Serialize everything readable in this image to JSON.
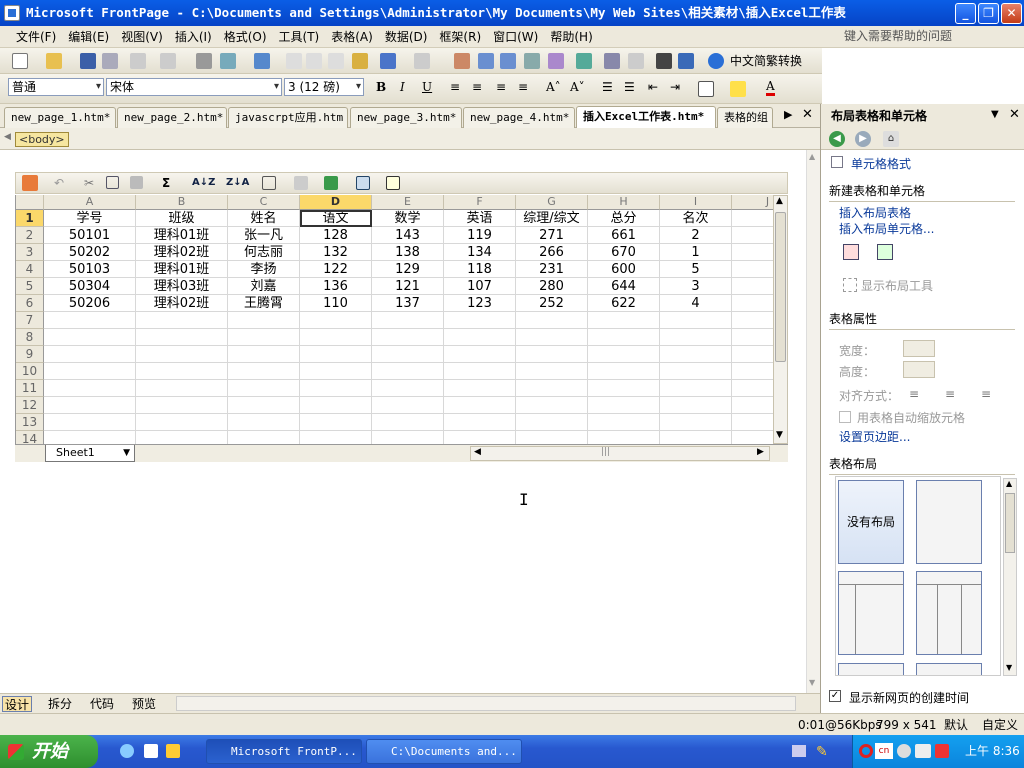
{
  "window": {
    "title": "Microsoft FrontPage - C:\\Documents and Settings\\Administrator\\My Documents\\My Web Sites\\相关素材\\插入Excel工作表"
  },
  "menu": {
    "items": [
      "文件(F)",
      "编辑(E)",
      "视图(V)",
      "插入(I)",
      "格式(O)",
      "工具(T)",
      "表格(A)",
      "数据(D)",
      "框架(R)",
      "窗口(W)",
      "帮助(H)"
    ],
    "help_placeholder": "键入需要帮助的问题"
  },
  "toolbar": {
    "convert_label": "中文简繁转换",
    "style_value": "普通",
    "font_value": "宋体",
    "size_value": "3 (12 磅)"
  },
  "tabs": [
    "new_page_1.htm*",
    "new_page_2.htm*",
    "javascrpt应用.htm",
    "new_page_3.htm*",
    "new_page_4.htm*",
    "插入Excel工作表.htm*",
    "表格的组"
  ],
  "breadcrumb": {
    "tag": "<body>"
  },
  "spreadsheet": {
    "columns": [
      "A",
      "B",
      "C",
      "D",
      "E",
      "F",
      "G",
      "H",
      "I",
      "J"
    ],
    "rows": [
      [
        "学号",
        "班级",
        "姓名",
        "语文",
        "数学",
        "英语",
        "综理/综文",
        "总分",
        "名次"
      ],
      [
        "50101",
        "理科01班",
        "张一凡",
        "128",
        "143",
        "119",
        "271",
        "661",
        "2"
      ],
      [
        "50202",
        "理科02班",
        "何志丽",
        "132",
        "138",
        "134",
        "266",
        "670",
        "1"
      ],
      [
        "50103",
        "理科01班",
        "李扬",
        "122",
        "129",
        "118",
        "231",
        "600",
        "5"
      ],
      [
        "50304",
        "理科03班",
        "刘嘉",
        "136",
        "121",
        "107",
        "280",
        "644",
        "3"
      ],
      [
        "50206",
        "理科02班",
        "王腾霄",
        "110",
        "137",
        "123",
        "252",
        "622",
        "4"
      ]
    ],
    "row_numbers": [
      "1",
      "2",
      "3",
      "4",
      "5",
      "6",
      "7",
      "8",
      "9",
      "10",
      "11",
      "12",
      "13",
      "14"
    ],
    "sheet_tab": "Sheet1"
  },
  "taskpane": {
    "title": "布局表格和单元格",
    "cell_format": "单元格格式",
    "new_section": "新建表格和单元格",
    "insert_table": "插入布局表格",
    "insert_cell": "插入布局单元格...",
    "show_tools": "显示布局工具",
    "props_section": "表格属性",
    "width_label": "宽度：",
    "height_label": "高度：",
    "align_label": "对齐方式：",
    "autofit_label": "用表格自动缩放元格",
    "margins_link": "设置页边距...",
    "layout_section": "表格布局",
    "no_layout": "没有布局",
    "show_time": "显示新网页的创建时间"
  },
  "views": [
    "设计",
    "拆分",
    "代码",
    "预览"
  ],
  "status": {
    "speed": "0:01@56Kbps",
    "size": "799 x 541",
    "default": "默认",
    "custom": "自定义"
  },
  "taskbar": {
    "start": "开始",
    "buttons": [
      "Microsoft FrontP...",
      "C:\\Documents and..."
    ],
    "clock": "上午 8:36"
  }
}
